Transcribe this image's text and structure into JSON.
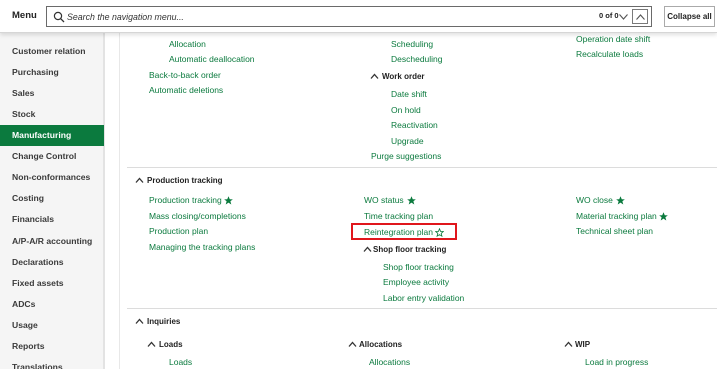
{
  "header": {
    "menu_label": "Menu",
    "search_placeholder": "Search the navigation menu...",
    "counter": "0 of 0",
    "collapse_label": "Collapse all"
  },
  "sidebar": {
    "active": "Manufacturing",
    "items": [
      {
        "label": "Customer relation"
      },
      {
        "label": "Purchasing"
      },
      {
        "label": "Sales"
      },
      {
        "label": "Stock"
      },
      {
        "label": "Manufacturing"
      },
      {
        "label": "Change Control"
      },
      {
        "label": "Non-conformances"
      },
      {
        "label": "Costing"
      },
      {
        "label": "Financials"
      },
      {
        "label": "A/P-A/R accounting"
      },
      {
        "label": "Declarations"
      },
      {
        "label": "Fixed assets"
      },
      {
        "label": "ADCs"
      },
      {
        "label": "Usage"
      },
      {
        "label": "Reports"
      },
      {
        "label": "Translations"
      }
    ]
  },
  "upper": {
    "col1": [
      "Allocation",
      "Automatic deallocation",
      "Back-to-back order",
      "Automatic deletions"
    ],
    "col2_top": [
      "Scheduling",
      "Descheduling"
    ],
    "work_order_header": "Work order",
    "work_order_items": [
      "Date shift",
      "On hold",
      "Reactivation",
      "Upgrade"
    ],
    "purge": "Purge suggestions",
    "col3": [
      "Operation date shift",
      "Recalculate loads"
    ]
  },
  "production_tracking": {
    "header": "Production tracking",
    "col1": [
      "Production tracking",
      "Mass closing/completions",
      "Production plan",
      "Managing the tracking plans"
    ],
    "col2": [
      "WO status",
      "Time tracking plan",
      "Reintegration plan"
    ],
    "shop_floor_header": "Shop floor tracking",
    "shop_floor_items": [
      "Shop floor tracking",
      "Employee activity",
      "Labor entry validation"
    ],
    "col3": [
      "WO close",
      "Material tracking plan",
      "Technical sheet plan"
    ]
  },
  "inquiries": {
    "header": "Inquiries",
    "loads_header": "Loads",
    "loads_items": [
      "Loads"
    ],
    "allocations_header": "Allocations",
    "allocations_items": [
      "Allocations"
    ],
    "wip_header": "WIP",
    "wip_items": [
      "Load in progress"
    ]
  },
  "colors": {
    "accent": "#0b7a3e",
    "highlight": "#e0161c"
  }
}
